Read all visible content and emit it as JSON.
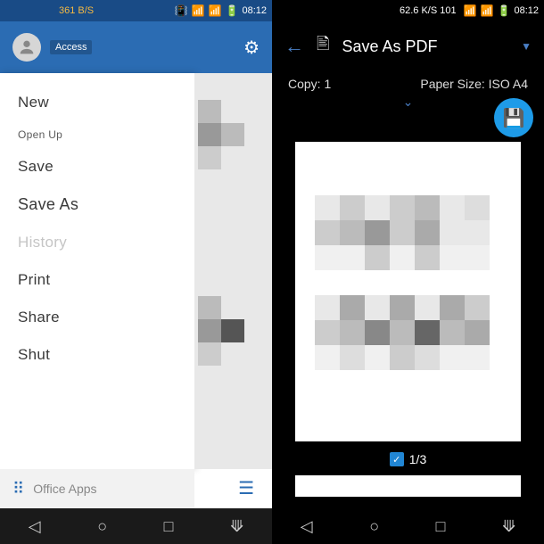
{
  "left": {
    "status": {
      "net": "361 B/S",
      "time": "08:12"
    },
    "header": {
      "access": "Access"
    },
    "menu": {
      "new": "New",
      "open": "Open Up",
      "save": "Save",
      "saveas": "Save As",
      "history": "History",
      "print": "Print",
      "share": "Share",
      "shut": "Shut"
    },
    "footer": {
      "officeApps": "Office Apps"
    }
  },
  "right": {
    "status": {
      "net": "62.6 K/S 101",
      "time": "08:12"
    },
    "header": {
      "title": "Save As PDF"
    },
    "options": {
      "copies": "Copy: 1",
      "paper": "Paper Size: ISO A4"
    },
    "pageIndicator": "1/3"
  }
}
